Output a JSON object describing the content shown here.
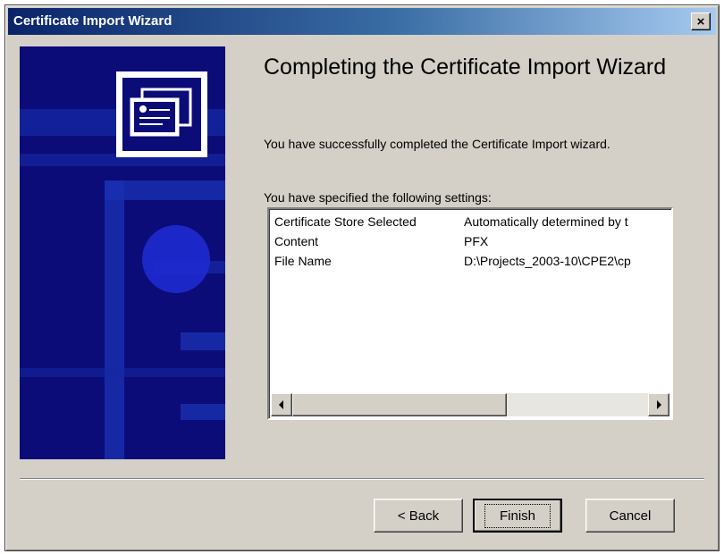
{
  "window": {
    "title": "Certificate Import Wizard",
    "close_label": "×"
  },
  "side_panel": {
    "icon": "certificate-icon",
    "colors": {
      "background": "#0b0c78",
      "stripe": "#1a2fb0",
      "circle": "#1e2ad0"
    }
  },
  "content": {
    "heading": "Completing the Certificate Import Wizard",
    "success_text": "You have successfully completed the Certificate Import wizard.",
    "settings_label": "You have specified the following settings:",
    "settings_rows": [
      {
        "field": "Certificate Store Selected",
        "value": "Automatically determined by t"
      },
      {
        "field": "Content",
        "value": "PFX"
      },
      {
        "field": "File Name",
        "value": "D:\\Projects_2003-10\\CPE2\\cp"
      }
    ],
    "scroll_left_icon": "scroll-left-arrow-icon",
    "scroll_right_icon": "scroll-right-arrow-icon"
  },
  "buttons": {
    "back_label": "< Back",
    "finish_label": "Finish",
    "cancel_label": "Cancel"
  }
}
